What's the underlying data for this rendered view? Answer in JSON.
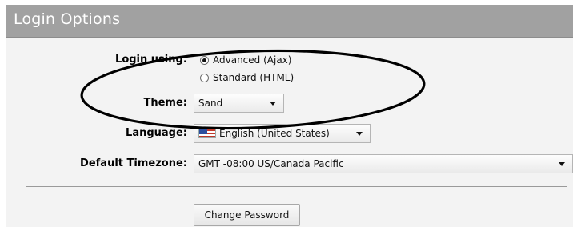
{
  "window": {
    "title": "Login Options"
  },
  "form": {
    "login_label": "Login using:",
    "login_options": [
      {
        "label": "Advanced (Ajax)",
        "selected": true
      },
      {
        "label": "Standard (HTML)",
        "selected": false
      }
    ],
    "theme_label": "Theme:",
    "theme_value": "Sand",
    "language_label": "Language:",
    "language_value": "English (United States)",
    "language_icon": "us-flag-icon",
    "timezone_label": "Default Timezone:",
    "timezone_value": "GMT -08:00 US/Canada Pacific",
    "change_password_label": "Change Password"
  },
  "colors": {
    "title_bar": "#a1a1a1",
    "panel": "#f3f3f3",
    "annotation": "#000000"
  }
}
